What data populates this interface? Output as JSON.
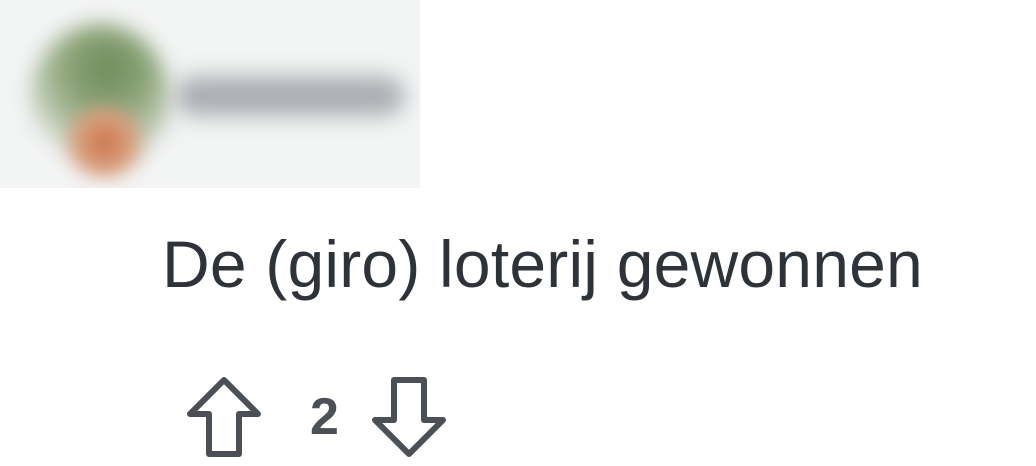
{
  "comment": {
    "text": "De (giro) loterij gewonnen"
  },
  "votes": {
    "score": "2",
    "upvote_icon": "arrow-up-outline-icon",
    "downvote_icon": "arrow-down-outline-icon"
  },
  "colors": {
    "text": "#2d3339",
    "icon_stroke": "#4a5056",
    "background": "#ffffff"
  }
}
